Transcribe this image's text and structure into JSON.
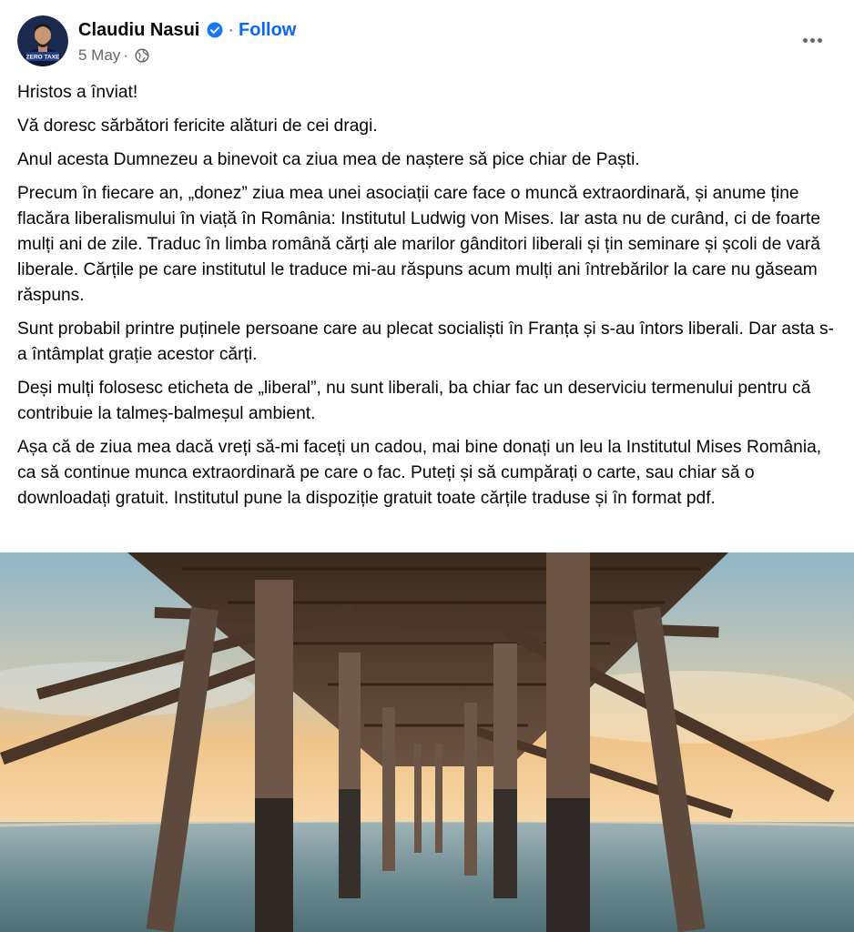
{
  "post": {
    "author": "Claudiu Nasui",
    "follow_label": "Follow",
    "separator": "·",
    "date": "5 May",
    "date_separator": "·",
    "avatar_badge_text": "ZERO TAXE",
    "paragraphs": [
      "Hristos a înviat!",
      "Vă doresc sărbători fericite alături de cei dragi.",
      "Anul acesta Dumnezeu a binevoit ca ziua mea de naștere să pice chiar de Paști.",
      "Precum în fiecare an, „donez” ziua mea unei asociații care face o muncă extraordinară, și anume ține flacăra liberalismului în viață în România: Institutul Ludwig von Mises. Iar asta nu de curând, ci de foarte mulți ani de zile. Traduc în limba română cărți ale marilor gânditori liberali și țin seminare și școli de vară liberale. Cărțile pe care institutul le traduce mi-au răspuns acum mulți ani întrebărilor la care nu găseam răspuns.",
      "Sunt probabil printre puținele persoane care au plecat socialiști în Franța și s-au întors liberali. Dar asta s-a întâmplat grație acestor cărți.",
      "Deși mulți folosesc eticheta de „liberal”, nu sunt liberali, ba chiar fac un deserviciu termenului pentru că contribuie la talmeș-balmeșul ambient.",
      "Așa că de ziua mea dacă vreți să-mi faceți un cadou, mai bine donați un leu la Institutul Mises România, ca să continue munca extraordinară pe care o fac. Puteți și să cumpărați o carte, sau chiar să o downloadați gratuit. Institutul pune la dispoziție gratuit toate cărțile traduse și în format pdf."
    ],
    "icons": {
      "verified": "verified-badge-icon",
      "audience": "globe-icon",
      "menu": "more-options-icon"
    }
  },
  "colors": {
    "link_blue": "#0866ff",
    "secondary_text": "#65676b",
    "primary_text": "#050505",
    "verified_blue": "#1877f2"
  }
}
